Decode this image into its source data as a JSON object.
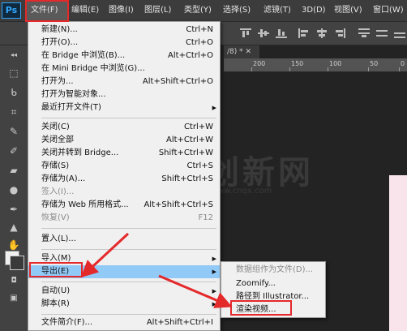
{
  "app": {
    "logo": "Ps",
    "menu": [
      "文件(F)",
      "编辑(E)",
      "图像(I)",
      "图层(L)",
      "类型(Y)",
      "选择(S)",
      "滤镜(T)",
      "3D(D)",
      "视图(V)",
      "窗口(W)"
    ]
  },
  "document": {
    "tab": "/8) * ✕",
    "ruler_ticks": [
      "200",
      "150",
      "100",
      "50",
      "0"
    ]
  },
  "watermark": {
    "title": "创新网",
    "subtitle": "www.cnqx.com"
  },
  "file_menu": {
    "items": [
      {
        "label": "新建(N)...",
        "shortcut": "Ctrl+N"
      },
      {
        "label": "打开(O)...",
        "shortcut": "Ctrl+O"
      },
      {
        "label": "在 Bridge 中浏览(B)...",
        "shortcut": "Alt+Ctrl+O"
      },
      {
        "label": "在 Mini Bridge 中浏览(G)...",
        "shortcut": ""
      },
      {
        "label": "打开为...",
        "shortcut": "Alt+Shift+Ctrl+O"
      },
      {
        "label": "打开为智能对象...",
        "shortcut": ""
      },
      {
        "label": "最近打开文件(T)",
        "shortcut": ""
      },
      {
        "label": "关闭(C)",
        "shortcut": "Ctrl+W"
      },
      {
        "label": "关闭全部",
        "shortcut": "Alt+Ctrl+W"
      },
      {
        "label": "关闭并转到 Bridge...",
        "shortcut": "Shift+Ctrl+W"
      },
      {
        "label": "存储(S)",
        "shortcut": "Ctrl+S"
      },
      {
        "label": "存储为(A)...",
        "shortcut": "Shift+Ctrl+S"
      },
      {
        "label": "签入(I)...",
        "shortcut": ""
      },
      {
        "label": "存储为 Web 所用格式...",
        "shortcut": "Alt+Shift+Ctrl+S"
      },
      {
        "label": "恢复(V)",
        "shortcut": "F12"
      },
      {
        "label": "置入(L)...",
        "shortcut": ""
      },
      {
        "label": "导入(M)",
        "shortcut": ""
      },
      {
        "label": "导出(E)",
        "shortcut": ""
      },
      {
        "label": "自动(U)",
        "shortcut": ""
      },
      {
        "label": "脚本(R)",
        "shortcut": ""
      },
      {
        "label": "文件简介(F)...",
        "shortcut": "Alt+Shift+Ctrl+I"
      }
    ]
  },
  "export_submenu": {
    "items": [
      {
        "label": "数据组作为文件(D)..."
      },
      {
        "label": "Zoomify..."
      },
      {
        "label": "路径到 Illustrator..."
      },
      {
        "label": "渲染视频..."
      }
    ]
  },
  "colors": {
    "highlight": "#91c9f7",
    "annotation_red": "#e4292b",
    "menu_bg": "#f0f0f0"
  }
}
